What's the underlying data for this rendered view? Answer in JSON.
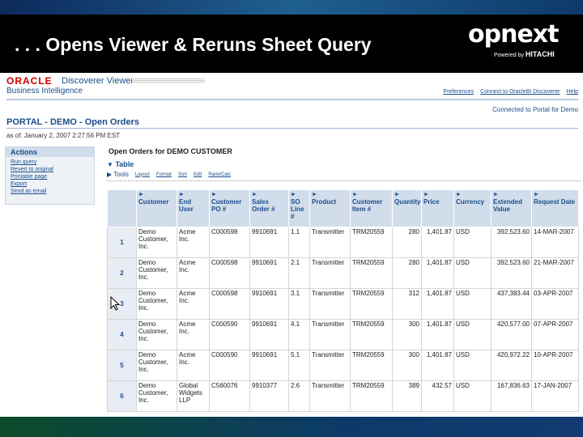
{
  "slide": {
    "title": ". . . Opens Viewer & Reruns Sheet Query",
    "logo_word": "opnext",
    "logo_powered": "Powered by",
    "logo_brand": "HITACHI"
  },
  "oracle": {
    "brand": "ORACLE",
    "app": "Discoverer Viewer",
    "suite": "Business Intelligence",
    "links": [
      "Preferences",
      "Connect to OracleBI Discoverer",
      "Help"
    ],
    "connected": "Connected to Portal for Demo"
  },
  "page": {
    "title": "PORTAL - DEMO - Open Orders",
    "as_of": "as of: January 2, 2007 2:27:56 PM EST"
  },
  "actions": {
    "heading": "Actions",
    "items": [
      "Run query",
      "Revert to original",
      "Printable page",
      "Export",
      "Send as email"
    ]
  },
  "worksheet": {
    "title": "Open Orders for DEMO CUSTOMER",
    "table_label": "Table",
    "tools_label": "Tools",
    "tools": [
      "Layout",
      "Format",
      "Sort",
      "Edit",
      "Rank/Calc"
    ]
  },
  "table": {
    "columns": [
      "Customer",
      "End User",
      "Customer PO #",
      "Sales Order #",
      "SO Line #",
      "Product",
      "Customer Item #",
      "Quantity",
      "Price",
      "Currency",
      "Extended Value",
      "Request Date"
    ],
    "rows": [
      {
        "n": "1",
        "c": [
          "Demo Customer, Inc.",
          "Acme Inc.",
          "C000598",
          "9910691",
          "1.1",
          "Transmitter",
          "TRM20559",
          "280",
          "1,401.87",
          "USD",
          "392,523.60",
          "14-MAR-2007"
        ]
      },
      {
        "n": "2",
        "c": [
          "Demo Customer, Inc.",
          "Acme Inc.",
          "C000598",
          "9910691",
          "2.1",
          "Transmitter",
          "TRM20559",
          "280",
          "1,401.87",
          "USD",
          "392,523.60",
          "21-MAR-2007"
        ]
      },
      {
        "n": "3",
        "c": [
          "Demo Customer, Inc.",
          "Acme Inc.",
          "C000598",
          "9910691",
          "3.1",
          "Transmitter",
          "TRM20559",
          "312",
          "1,401.87",
          "USD",
          "437,383.44",
          "03-APR-2007"
        ]
      },
      {
        "n": "4",
        "c": [
          "Demo Customer, Inc.",
          "Acme Inc.",
          "C000590",
          "9910691",
          "4.1",
          "Transmitter",
          "TRM20559",
          "300",
          "1,401.87",
          "USD",
          "420,577.00",
          "07-APR-2007"
        ]
      },
      {
        "n": "5",
        "c": [
          "Demo Customer, Inc.",
          "Acme Inc.",
          "C000590",
          "9910691",
          "5.1",
          "Transmitter",
          "TRM20559",
          "300",
          "1,401.87",
          "USD",
          "420,972.22",
          "10-APR-2007"
        ]
      },
      {
        "n": "6",
        "c": [
          "Demo Customer, Inc.",
          "Global Widgets LLP",
          "C560076",
          "9910377",
          "2.6",
          "Transmitter",
          "TRM20559",
          "389",
          "432.57",
          "USD",
          "167,836.63",
          "17-JAN-2007"
        ]
      }
    ]
  },
  "colors": {
    "title_bar": "#000000",
    "oracle_red": "#cc0000",
    "link_blue": "#1a4e8c",
    "header_bg": "#d2ddeb"
  }
}
